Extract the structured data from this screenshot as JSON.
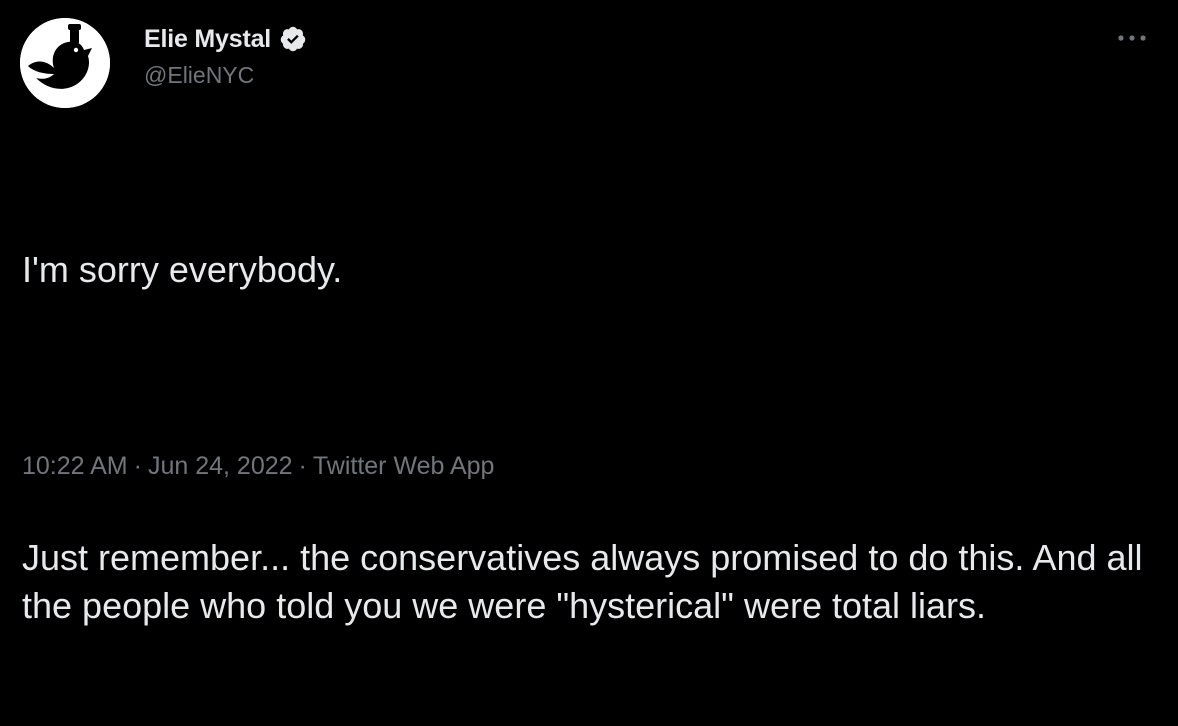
{
  "author": {
    "display_name": "Elie Mystal",
    "handle": "@ElieNYC",
    "verified": true,
    "avatar_icon": "bird-with-raised-fist-avatar"
  },
  "tweet": {
    "paragraph_1": "I'm sorry everybody.",
    "paragraph_2": "Just remember... the conservatives always promised to do this. And all the people who told you we were \"hysterical\" were total liars."
  },
  "meta": {
    "time": "10:22 AM",
    "separator": "·",
    "date": "Jun 24, 2022",
    "source": "Twitter Web App"
  },
  "icons": {
    "more": "more-options-icon",
    "verified": "verified-badge-icon"
  },
  "colors": {
    "background": "#000000",
    "primary_text": "#e7e9ea",
    "secondary_text": "#71767b"
  }
}
